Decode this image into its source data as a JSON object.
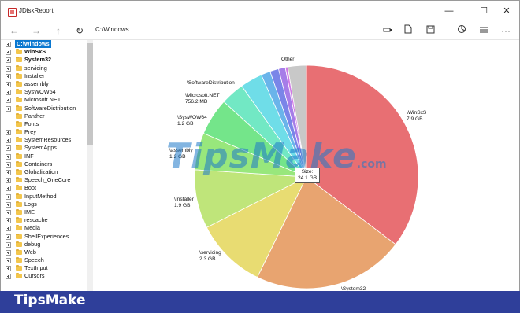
{
  "window": {
    "title": "JDiskReport",
    "min_glyph": "—",
    "max_glyph": "☐",
    "close_glyph": "✕"
  },
  "toolbar": {
    "path": "C:\\Windows",
    "back_glyph": "←",
    "forward_glyph": "→",
    "up_glyph": "↑",
    "refresh_glyph": "↻",
    "more_glyph": "···"
  },
  "tree": {
    "root": "C:\\Windows",
    "items": [
      {
        "label": "WinSxS",
        "bold": true,
        "expander": true
      },
      {
        "label": "System32",
        "bold": true,
        "expander": true
      },
      {
        "label": "servicing",
        "bold": false,
        "expander": true
      },
      {
        "label": "Installer",
        "bold": false,
        "expander": true
      },
      {
        "label": "assembly",
        "bold": false,
        "expander": true
      },
      {
        "label": "SysWOW64",
        "bold": false,
        "expander": true
      },
      {
        "label": "Microsoft.NET",
        "bold": false,
        "expander": true
      },
      {
        "label": "SoftwareDistribution",
        "bold": false,
        "expander": true
      },
      {
        "label": "Panther",
        "bold": false,
        "expander": false
      },
      {
        "label": "Fonts",
        "bold": false,
        "expander": false
      },
      {
        "label": "Prey",
        "bold": false,
        "expander": true
      },
      {
        "label": "SystemResources",
        "bold": false,
        "expander": true
      },
      {
        "label": "SystemApps",
        "bold": false,
        "expander": true
      },
      {
        "label": "INF",
        "bold": false,
        "expander": true
      },
      {
        "label": "Containers",
        "bold": false,
        "expander": true
      },
      {
        "label": "Globalization",
        "bold": false,
        "expander": true
      },
      {
        "label": "Speech_OneCore",
        "bold": false,
        "expander": true
      },
      {
        "label": "Boot",
        "bold": false,
        "expander": true
      },
      {
        "label": "InputMethod",
        "bold": false,
        "expander": true
      },
      {
        "label": "Logs",
        "bold": false,
        "expander": true
      },
      {
        "label": "IME",
        "bold": false,
        "expander": true
      },
      {
        "label": "rescache",
        "bold": false,
        "expander": true
      },
      {
        "label": "Media",
        "bold": false,
        "expander": true
      },
      {
        "label": "ShellExperiences",
        "bold": false,
        "expander": true
      },
      {
        "label": "debug",
        "bold": false,
        "expander": true
      },
      {
        "label": "Web",
        "bold": false,
        "expander": true
      },
      {
        "label": "Speech",
        "bold": false,
        "expander": true
      },
      {
        "label": "TextInput",
        "bold": false,
        "expander": true
      },
      {
        "label": "Cursors",
        "bold": false,
        "expander": true
      }
    ]
  },
  "chart_data": {
    "type": "pie",
    "center_label": "Size:",
    "center_value": "24.1 GB",
    "slices": [
      {
        "name": "\\WinSxS",
        "size": "7.9 GB",
        "value": 7.9,
        "color": "#e86f73"
      },
      {
        "name": "\\System32",
        "size": "",
        "value": 4.9,
        "color": "#e8a470"
      },
      {
        "name": "\\servicing",
        "size": "2.3 GB",
        "value": 2.3,
        "color": "#e8dc72"
      },
      {
        "name": "\\Installer",
        "size": "1.9 GB",
        "value": 1.9,
        "color": "#bfe57a"
      },
      {
        "name": "\\assembly",
        "size": "1.2 GB",
        "value": 1.2,
        "color": "#98e77c"
      },
      {
        "name": "\\SysWOW64",
        "size": "1.2 GB",
        "value": 1.2,
        "color": "#74e58a"
      },
      {
        "name": "\\Microsoft.NET",
        "size": "756.2 MB",
        "value": 0.76,
        "color": "#72e8c4"
      },
      {
        "name": "\\SoftwareDistribution",
        "size": "",
        "value": 0.72,
        "color": "#6fdde8"
      },
      {
        "name": "",
        "size": "",
        "value": 0.3,
        "color": "#6ab4ea"
      },
      {
        "name": "",
        "size": "",
        "value": 0.28,
        "color": "#7a85e8"
      },
      {
        "name": "",
        "size": "",
        "value": 0.22,
        "color": "#a67de8"
      },
      {
        "name": "",
        "size": "",
        "value": 0.08,
        "color": "#d07ae6"
      },
      {
        "name": "Other",
        "size": "",
        "value": 0.6,
        "color": "#c8c8c8"
      }
    ]
  },
  "watermark": {
    "text": "TipsMake",
    "domain": ".com"
  },
  "banner": {
    "text": "TipsMake",
    "color": "#2f3f9a"
  }
}
